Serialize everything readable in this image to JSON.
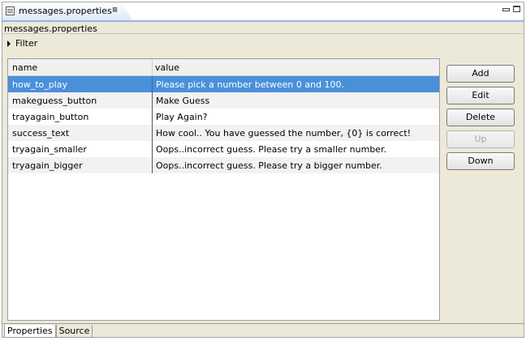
{
  "editor": {
    "tab_title": "messages.properties",
    "doc_title": "messages.properties"
  },
  "filter": {
    "label": "Filter"
  },
  "table": {
    "columns": [
      "name",
      "value"
    ],
    "rows": [
      {
        "name": "how_to_play",
        "value": "Please pick a number between 0 and 100."
      },
      {
        "name": "makeguess_button",
        "value": "Make Guess"
      },
      {
        "name": "trayagain_button",
        "value": "Play Again?"
      },
      {
        "name": "success_text",
        "value": "How cool.. You have guessed the number, {0} is correct!"
      },
      {
        "name": "tryagain_smaller",
        "value": "Oops..incorrect guess. Please try a smaller number."
      },
      {
        "name": "tryagain_bigger",
        "value": "Oops..incorrect guess. Please try a bigger number."
      }
    ],
    "selected_row": 0
  },
  "buttons": {
    "add": "Add",
    "edit": "Edit",
    "delete": "Delete",
    "up": "Up",
    "down": "Down"
  },
  "bottom_tabs": [
    "Properties",
    "Source"
  ],
  "colors": {
    "selection": "#4a90d9",
    "tab_accent": "#98b5e2"
  }
}
